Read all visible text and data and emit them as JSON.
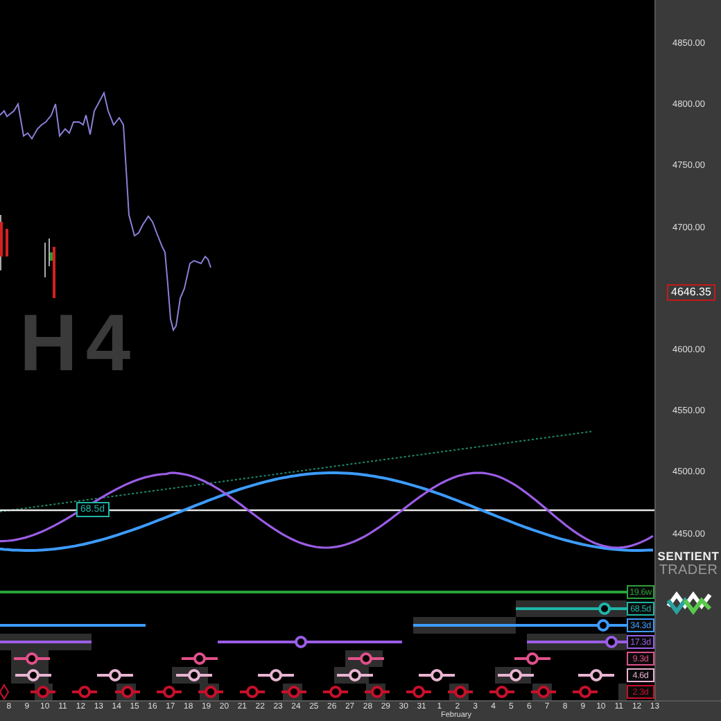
{
  "chart": {
    "watermark": "H4",
    "cycle_tag": "68.5d",
    "price_marker": "4646.35"
  },
  "price_axis": [
    "4850.00",
    "4800.00",
    "4750.00",
    "4700.00",
    "4600.00",
    "4550.00",
    "4500.00",
    "4450.00"
  ],
  "cycles": [
    {
      "label": "19.6w",
      "color": "#2aa13a"
    },
    {
      "label": "68.5d",
      "color": "#1fb5a8"
    },
    {
      "label": "34.3d",
      "color": "#3d9cff"
    },
    {
      "label": "17.3d",
      "color": "#9b5de5"
    },
    {
      "label": "9.3d",
      "color": "#e0508a"
    },
    {
      "label": "4.6d",
      "color": "#e8b4d2"
    },
    {
      "label": "2.3d",
      "color": "#c8102a"
    }
  ],
  "date_axis": {
    "days": [
      "8",
      "9",
      "10",
      "11",
      "12",
      "13",
      "14",
      "15",
      "16",
      "17",
      "18",
      "19",
      "20",
      "21",
      "22",
      "23",
      "24",
      "25",
      "26",
      "27",
      "28",
      "29",
      "30",
      "31",
      "1",
      "2",
      "3",
      "4",
      "5",
      "6",
      "7",
      "8",
      "9",
      "10",
      "11",
      "12",
      "13"
    ],
    "month": "February"
  },
  "brand": {
    "line1": "SENTIENT",
    "line2": "TRADER"
  }
}
